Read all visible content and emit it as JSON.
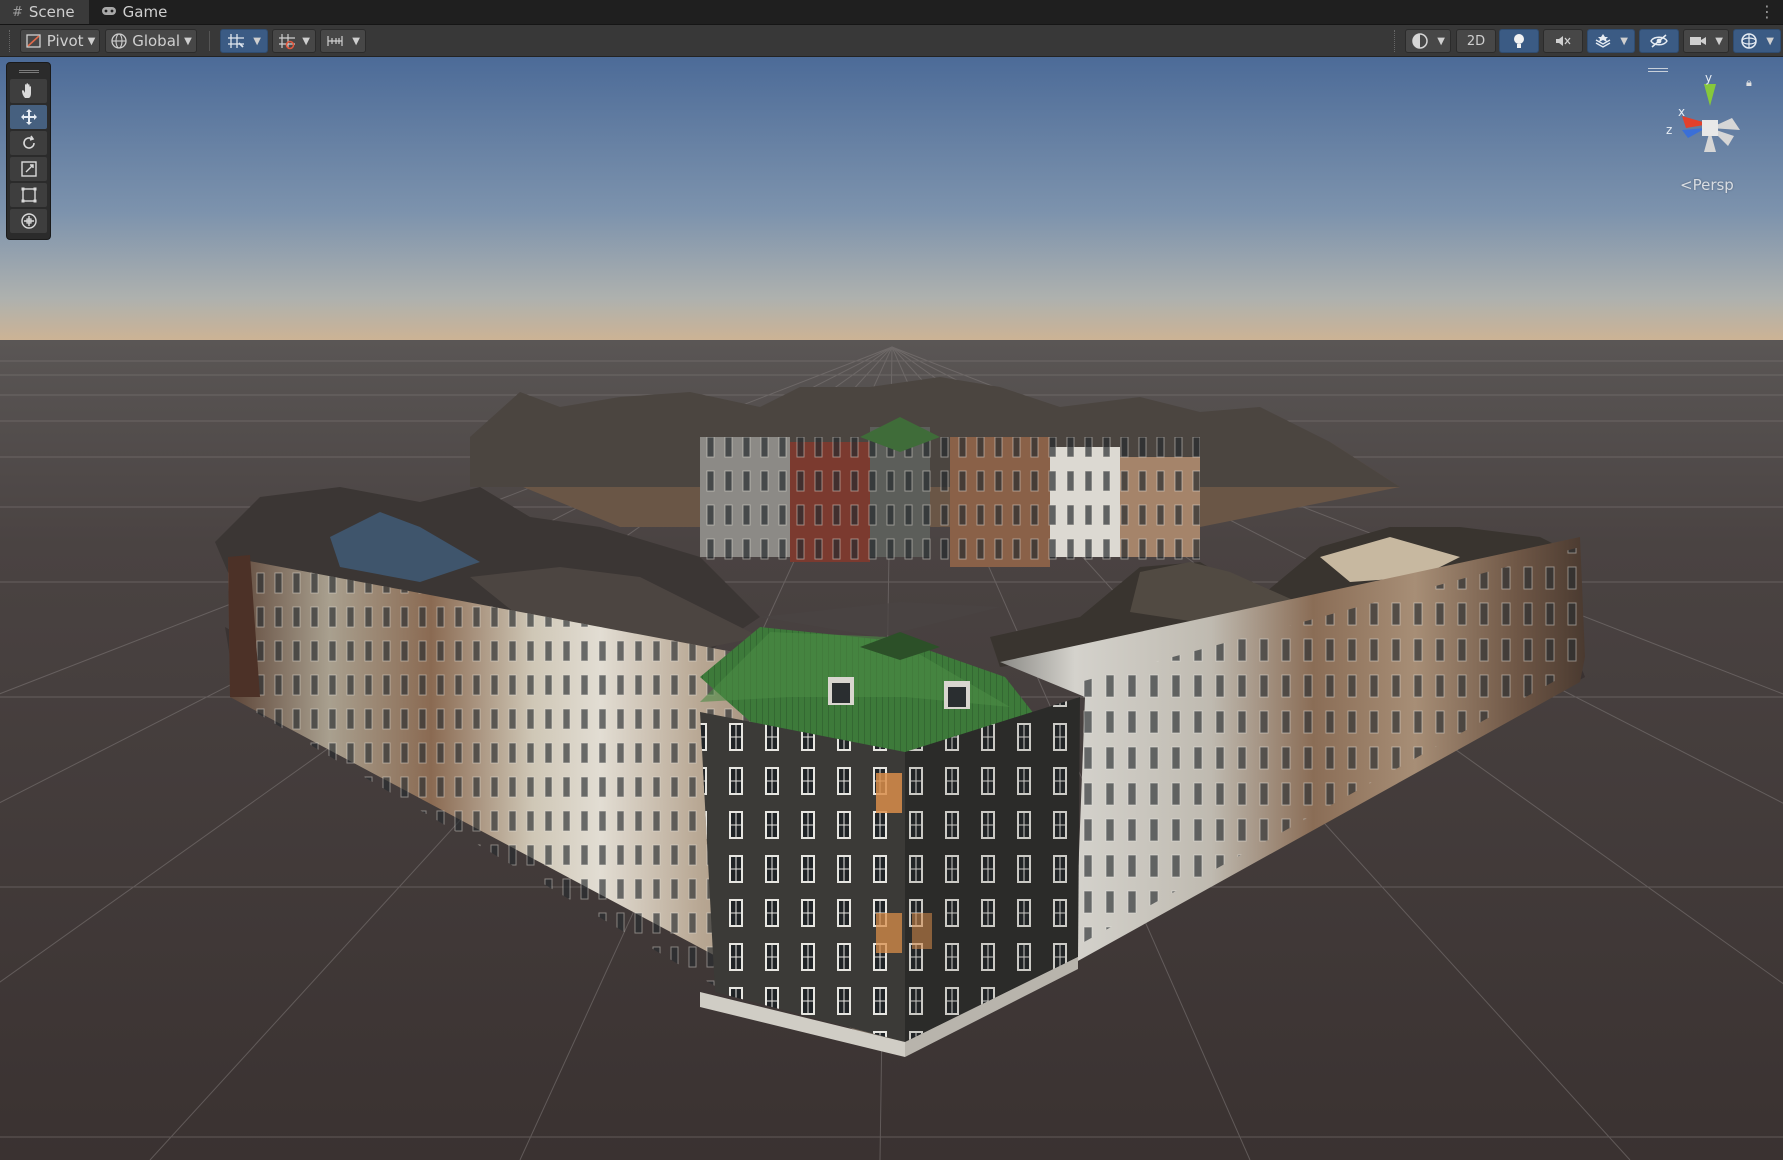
{
  "tabs": [
    {
      "label": "Scene",
      "icon": "hash-icon",
      "active": true
    },
    {
      "label": "Game",
      "icon": "gamepad-icon",
      "active": false
    }
  ],
  "toolbar": {
    "pivot_label": "Pivot",
    "global_label": "Global",
    "mode_2d_label": "2D"
  },
  "tools": [
    {
      "name": "hand-tool",
      "icon": "hand-icon"
    },
    {
      "name": "move-tool",
      "icon": "move-icon",
      "active": true
    },
    {
      "name": "rotate-tool",
      "icon": "rotate-icon"
    },
    {
      "name": "scale-tool",
      "icon": "scale-icon"
    },
    {
      "name": "rect-tool",
      "icon": "rect-icon"
    },
    {
      "name": "transform-tool",
      "icon": "transform-icon"
    }
  ],
  "gizmo": {
    "axis_y": "y",
    "axis_x": "x",
    "axis_z": "z",
    "projection_label": "Persp"
  },
  "colors": {
    "active_blue": "#3b5b84",
    "sky_top": "#4d6c99",
    "sky_horizon": "#c6b094",
    "ground": "#3e3736",
    "gizmo_x": "#e3402b",
    "gizmo_y": "#86c83c",
    "gizmo_z": "#3a6fd8"
  }
}
